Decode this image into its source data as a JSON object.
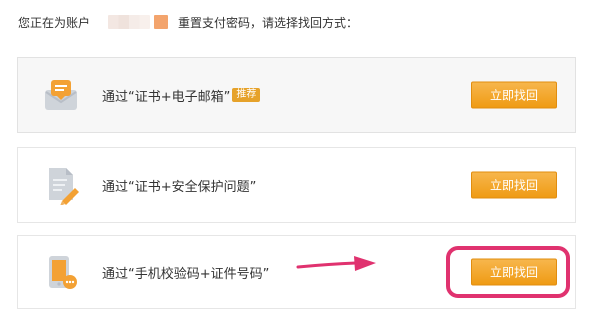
{
  "header": {
    "text_before": "您正在为账户",
    "text_after": "重置支付密码，请选择找回方式："
  },
  "options": [
    {
      "label": "通过“证书+电子邮箱”",
      "badge": "推荐",
      "button_label": "立即找回",
      "icon": "envelope-icon"
    },
    {
      "label": "通过“证书+安全保护问题”",
      "button_label": "立即找回",
      "icon": "document-pencil-icon"
    },
    {
      "label": "通过“手机校验码+证件号码”",
      "button_label": "立即找回",
      "icon": "phone-chat-icon"
    }
  ],
  "colors": {
    "button": "#ef9b14",
    "badge": "#e6a22a",
    "annotation": "#e0326f"
  }
}
